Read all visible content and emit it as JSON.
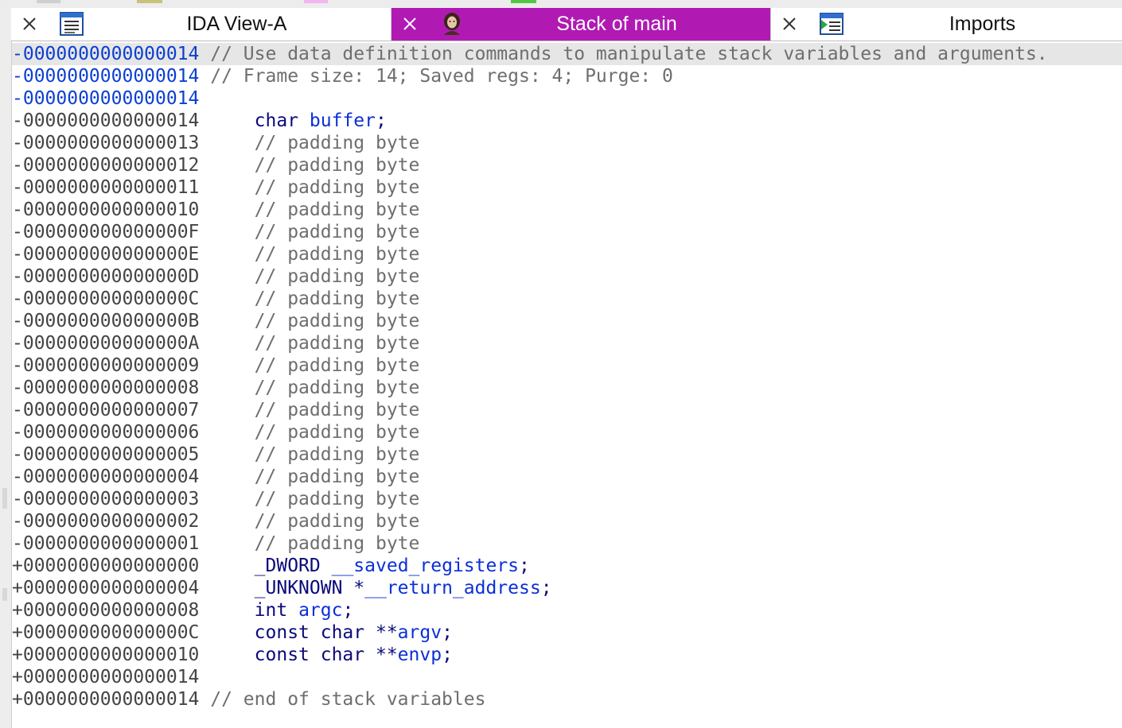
{
  "tabs": [
    {
      "label": "IDA View-A",
      "active": false,
      "icon": "listing-view-icon"
    },
    {
      "label": "Stack of main",
      "active": true,
      "icon": "portrait-icon"
    },
    {
      "label": "Imports",
      "active": false,
      "icon": "imports-table-icon"
    }
  ],
  "colors": {
    "active_tab": "#b01ab3",
    "address_highlight": "#0b3fd1",
    "identifier": "#0b2fd8",
    "keyword": "#0a0a7a",
    "comment": "#6e6e6e"
  },
  "lines": [
    {
      "addr": "-0000000000000014",
      "comment": "// Use data definition commands to manipulate stack variables and arguments."
    },
    {
      "addr": "-0000000000000014",
      "comment": "// Frame size: 14; Saved regs: 4; Purge: 0"
    },
    {
      "addr": "-0000000000000014"
    },
    {
      "addr": "-0000000000000014",
      "type": "char",
      "name": "buffer",
      "end": ";"
    },
    {
      "addr": "-0000000000000013",
      "comment": "// padding byte"
    },
    {
      "addr": "-0000000000000012",
      "comment": "// padding byte"
    },
    {
      "addr": "-0000000000000011",
      "comment": "// padding byte"
    },
    {
      "addr": "-0000000000000010",
      "comment": "// padding byte"
    },
    {
      "addr": "-000000000000000F",
      "comment": "// padding byte"
    },
    {
      "addr": "-000000000000000E",
      "comment": "// padding byte"
    },
    {
      "addr": "-000000000000000D",
      "comment": "// padding byte"
    },
    {
      "addr": "-000000000000000C",
      "comment": "// padding byte"
    },
    {
      "addr": "-000000000000000B",
      "comment": "// padding byte"
    },
    {
      "addr": "-000000000000000A",
      "comment": "// padding byte"
    },
    {
      "addr": "-0000000000000009",
      "comment": "// padding byte"
    },
    {
      "addr": "-0000000000000008",
      "comment": "// padding byte"
    },
    {
      "addr": "-0000000000000007",
      "comment": "// padding byte"
    },
    {
      "addr": "-0000000000000006",
      "comment": "// padding byte"
    },
    {
      "addr": "-0000000000000005",
      "comment": "// padding byte"
    },
    {
      "addr": "-0000000000000004",
      "comment": "// padding byte"
    },
    {
      "addr": "-0000000000000003",
      "comment": "// padding byte"
    },
    {
      "addr": "-0000000000000002",
      "comment": "// padding byte"
    },
    {
      "addr": "-0000000000000001",
      "comment": "// padding byte"
    },
    {
      "addr": "+0000000000000000",
      "type": "_DWORD",
      "name": "__saved_registers",
      "end": ";"
    },
    {
      "addr": "+0000000000000004",
      "type": "_UNKNOWN *",
      "name": "__return_address",
      "end": ";"
    },
    {
      "addr": "+0000000000000008",
      "type": "int",
      "name": "argc",
      "end": ";"
    },
    {
      "addr": "+000000000000000C",
      "type": "const char **",
      "name": "argv",
      "end": ";"
    },
    {
      "addr": "+0000000000000010",
      "type": "const char **",
      "name": "envp",
      "end": ";"
    },
    {
      "addr": "+0000000000000014"
    },
    {
      "addr": "+0000000000000014",
      "comment": "// end of stack variables"
    }
  ]
}
